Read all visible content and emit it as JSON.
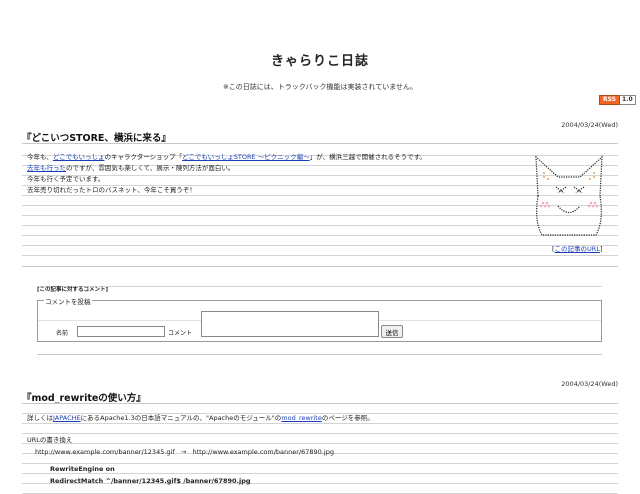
{
  "site": {
    "title": "きゃらりこ日誌",
    "notice": "※この日誌には、トラックバック機能は実装されていません。",
    "rss_label": "RSS",
    "rss_version": "1.0"
  },
  "entry1": {
    "date": "2004/03/24(Wed)",
    "title": "『どこいつSTORE、横浜に来る』",
    "lines": [
      {
        "pre": "今年も、",
        "link": "どこでもいっしょ",
        "post": "のキャラクターショップ「",
        "link2": "どこでもいっしょSTORE 〜ピクニック編〜",
        "post2": "」が、横浜三越で開催されるそうです。"
      },
      {
        "pre": "",
        "link": "去年も行った",
        "post": "のですが、雰囲気も楽しくて、展示・陳列方法が面白い。",
        "link2": "",
        "post2": ""
      },
      {
        "pre": "今年も行く予定でいます。",
        "link": "",
        "post": "",
        "link2": "",
        "post2": ""
      },
      {
        "pre": "去年売り切れだったトロのバスネット、今年こそ買うぞ！",
        "link": "",
        "post": "",
        "link2": "",
        "post2": ""
      }
    ],
    "article_url_prefix": "[",
    "article_url_label": "この記事のURL",
    "article_url_suffix": "]"
  },
  "comments": {
    "header": "[この記事に対するコメント]",
    "legend": "コメントを投稿",
    "name_label": "名前",
    "comment_label": "コメント",
    "submit_label": "送信",
    "name_value": "",
    "comment_value": ""
  },
  "entry2": {
    "date": "2004/03/24(Wed)",
    "title": "『mod_rewriteの使い方』",
    "intro_pre": "詳しくは",
    "intro_link1": "JAPACHE",
    "intro_mid": "にあるApache1.3の日本語マニュアルの、\"Apacheのモジュール\"の",
    "intro_link2": "mod_rewrite",
    "intro_post": "のページを参照。",
    "section_label": "URLの書き換え",
    "example_from": "http://www.example.com/banner/12345.gif",
    "example_arrow": "→",
    "example_to": "http://www.example.com/banner/67890.jpg",
    "code_line1": "RewriteEngine on",
    "code_line2": "RedirectMatch ^/banner/12345.gif$ /banner/67890.jpg"
  },
  "colors": {
    "link": "#1a3fb8",
    "rss_orange": "#f26522"
  }
}
